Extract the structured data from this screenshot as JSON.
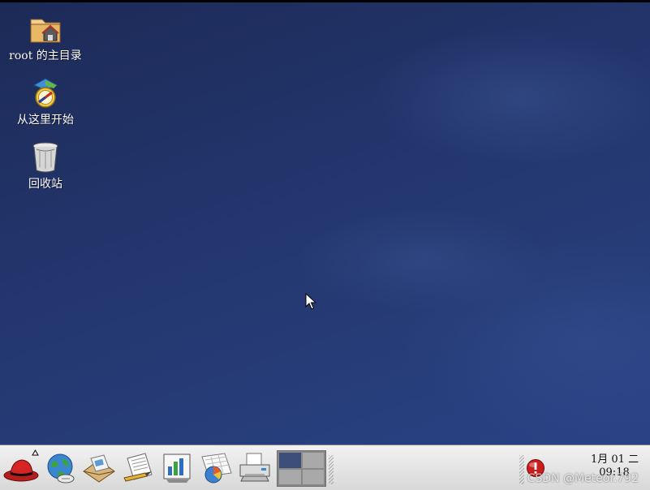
{
  "desktop": {
    "icons": [
      {
        "label": "root 的主目录",
        "icon": "home-folder-icon"
      },
      {
        "label": "从这里开始",
        "icon": "compass-start-icon"
      },
      {
        "label": "回收站",
        "icon": "trash-icon"
      }
    ]
  },
  "panel": {
    "launchers": [
      {
        "name": "redhat-menu-icon"
      },
      {
        "name": "web-browser-icon"
      },
      {
        "name": "email-icon"
      },
      {
        "name": "text-editor-icon"
      },
      {
        "name": "presentation-icon"
      },
      {
        "name": "spreadsheet-icon"
      },
      {
        "name": "printer-icon"
      }
    ],
    "workspaces": {
      "count": 4,
      "active_index": 0
    },
    "clock": {
      "date": "1月 01 二",
      "time": "09:18"
    }
  },
  "watermark": "CSDN @Meteor.792",
  "colors": {
    "desktop_bg": "#23366d",
    "panel_bg": "#e3e3e3",
    "active_workspace": "#3c4f7a",
    "alert_red": "#cc1d1d"
  }
}
